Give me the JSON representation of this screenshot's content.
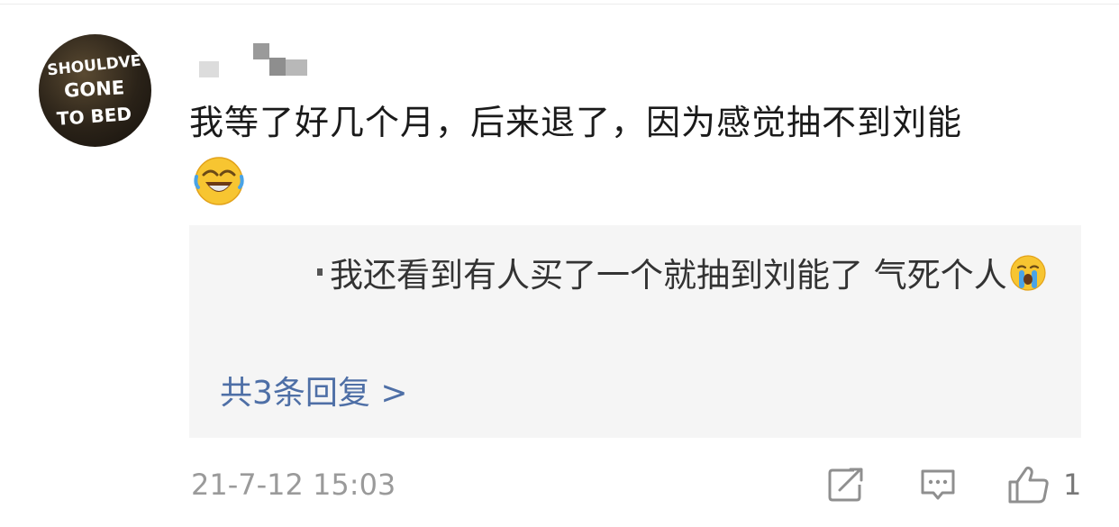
{
  "comment": {
    "avatar_text": [
      "SHOULDVE",
      "GONE",
      "TO BED"
    ],
    "text": "我等了好几个月，后来退了，因为感觉抽不到刘能",
    "emoji": "laugh-cry-emoji"
  },
  "reply": {
    "text": "我还看到有人买了一个就抽到刘能了 气死个人",
    "emoji": "crying-emoji",
    "more_label": "共3条回复 >"
  },
  "footer": {
    "timestamp": "21-7-12 15:03",
    "like_count": "1",
    "icons": [
      "share-icon",
      "comment-icon",
      "like-icon"
    ]
  },
  "colors": {
    "link": "#4e6fa6",
    "text": "#1a1a1a",
    "muted": "#9a9a9a",
    "reply_bg": "#f5f5f5"
  }
}
